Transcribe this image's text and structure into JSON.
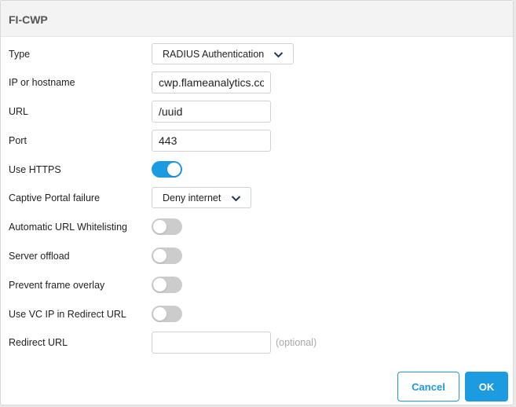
{
  "dialog": {
    "title": "FI-CWP"
  },
  "fields": {
    "type": {
      "label": "Type",
      "value": "RADIUS Authentication",
      "icon": "chevron-down-icon"
    },
    "host": {
      "label": "IP or hostname",
      "value": "cwp.flameanalytics.cor"
    },
    "url": {
      "label": "URL",
      "value": "/uuid"
    },
    "port": {
      "label": "Port",
      "value": "443"
    },
    "https": {
      "label": "Use HTTPS",
      "on": true
    },
    "captive_failure": {
      "label": "Captive Portal failure",
      "value": "Deny internet",
      "icon": "chevron-down-icon"
    },
    "auto_whitelist": {
      "label": "Automatic URL Whitelisting",
      "on": false
    },
    "server_offload": {
      "label": "Server offload",
      "on": false
    },
    "prevent_overlay": {
      "label": "Prevent frame overlay",
      "on": false
    },
    "vc_ip": {
      "label": "Use VC IP in Redirect URL",
      "on": false
    },
    "redirect": {
      "label": "Redirect URL",
      "value": "",
      "placeholder": "",
      "hint": "(optional)"
    }
  },
  "buttons": {
    "cancel": "Cancel",
    "ok": "OK"
  },
  "colors": {
    "accent": "#1d9be1",
    "toggle_off": "#cccccc",
    "header_bg": "#f3f3f3"
  }
}
